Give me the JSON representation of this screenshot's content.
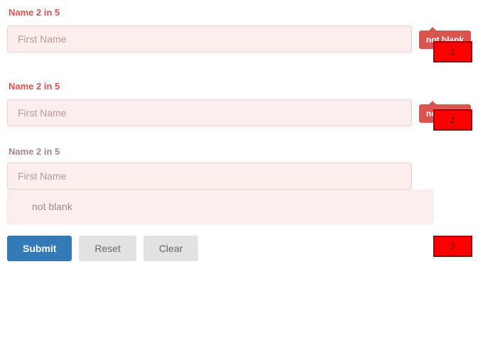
{
  "groups": [
    {
      "label": "Name 2 in 5",
      "placeholder": "First Name",
      "tooltip": "not blank"
    },
    {
      "label": "Name 2 in 5",
      "placeholder": "First Name",
      "tooltip": "not blank"
    },
    {
      "label": "Name 2 in 5",
      "placeholder": "First Name",
      "message": "not blank"
    }
  ],
  "buttons": {
    "submit": "Submit",
    "reset": "Reset",
    "clear": "Clear"
  },
  "annotations": {
    "a1": "1",
    "a2": "2",
    "a3": "3"
  }
}
